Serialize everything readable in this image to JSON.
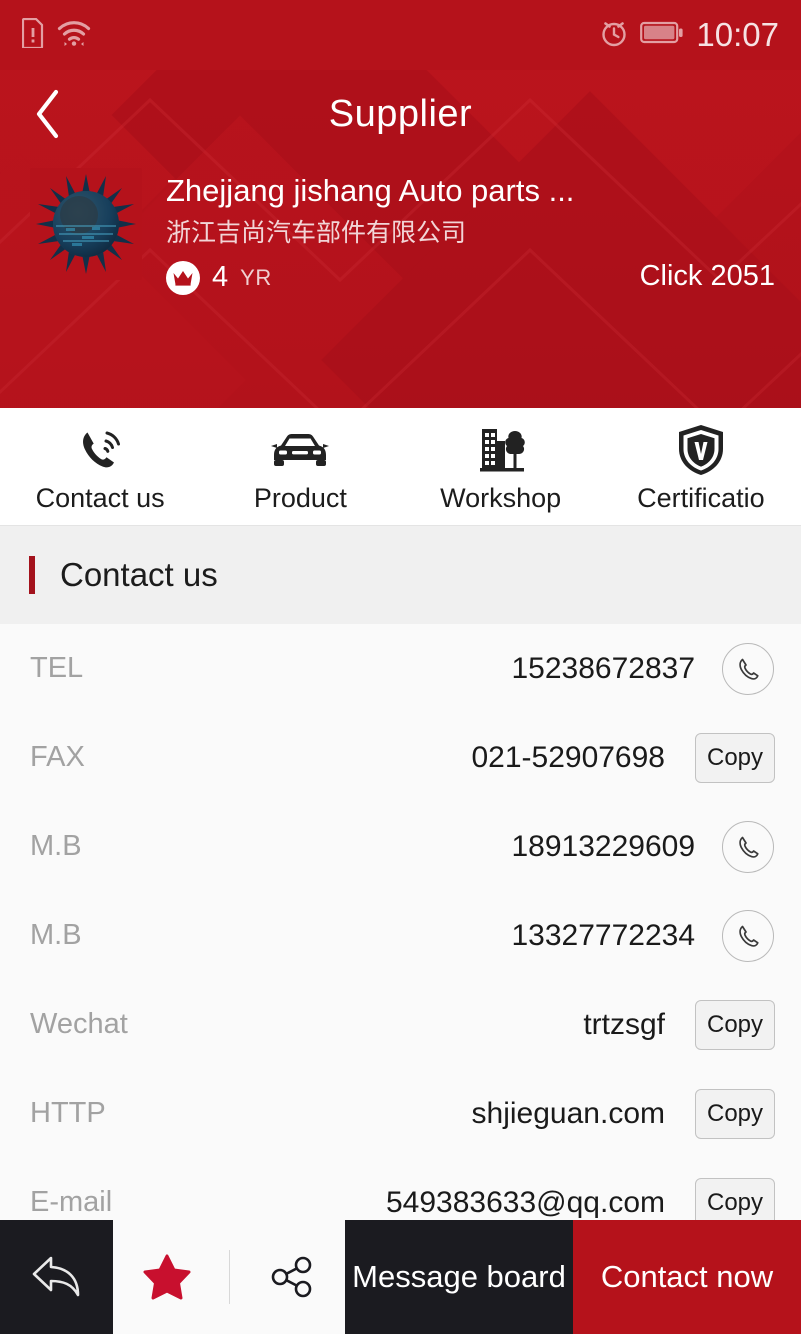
{
  "status_bar": {
    "icons": [
      "sim-missing-icon",
      "wifi-icon",
      "alarm-icon",
      "battery-icon"
    ],
    "time": "10:07",
    "background_color": "#b5121b"
  },
  "header": {
    "back_icon": "back-chevron-icon",
    "title": "Supplier",
    "background_color": "#b5121b"
  },
  "supplier": {
    "logo_alt": "spiky-sphere-logo",
    "name_en": "Zhejjang jishang Auto parts ...",
    "name_cn": "浙江吉尚汽车部件有限公司",
    "badge_icon": "crown-icon",
    "years": "4",
    "years_unit": "YR",
    "clicks": "Click 2051"
  },
  "tabs": [
    {
      "label": "Contact us",
      "icon": "phone-ring-icon"
    },
    {
      "label": "Product",
      "icon": "car-icon"
    },
    {
      "label": "Workshop",
      "icon": "factory-tree-icon"
    },
    {
      "label": "Certificatio",
      "icon": "shield-v-icon"
    }
  ],
  "section": {
    "title": "Contact us",
    "accent_color": "#a3121c"
  },
  "contacts": [
    {
      "label": "TEL",
      "value": "15238672837",
      "action": "call",
      "action_label": ""
    },
    {
      "label": "FAX",
      "value": "021-52907698",
      "action": "copy",
      "action_label": "Copy"
    },
    {
      "label": "M.B",
      "value": "18913229609",
      "action": "call",
      "action_label": ""
    },
    {
      "label": "M.B",
      "value": "13327772234",
      "action": "call",
      "action_label": ""
    },
    {
      "label": "Wechat",
      "value": "trtzsgf",
      "action": "copy",
      "action_label": "Copy"
    },
    {
      "label": "HTTP",
      "value": "shjieguan.com",
      "action": "copy",
      "action_label": "Copy"
    },
    {
      "label": "E-mail",
      "value": "549383633@qq.com",
      "action": "copy",
      "action_label": "Copy"
    }
  ],
  "bottom_bar": {
    "back_icon": "reply-arrow-icon",
    "favorite_icon": "star-icon",
    "favorite_color": "#c8102e",
    "share_icon": "share-icon",
    "message_label": "Message board",
    "contact_label": "Contact now",
    "contact_color": "#b5121b"
  }
}
